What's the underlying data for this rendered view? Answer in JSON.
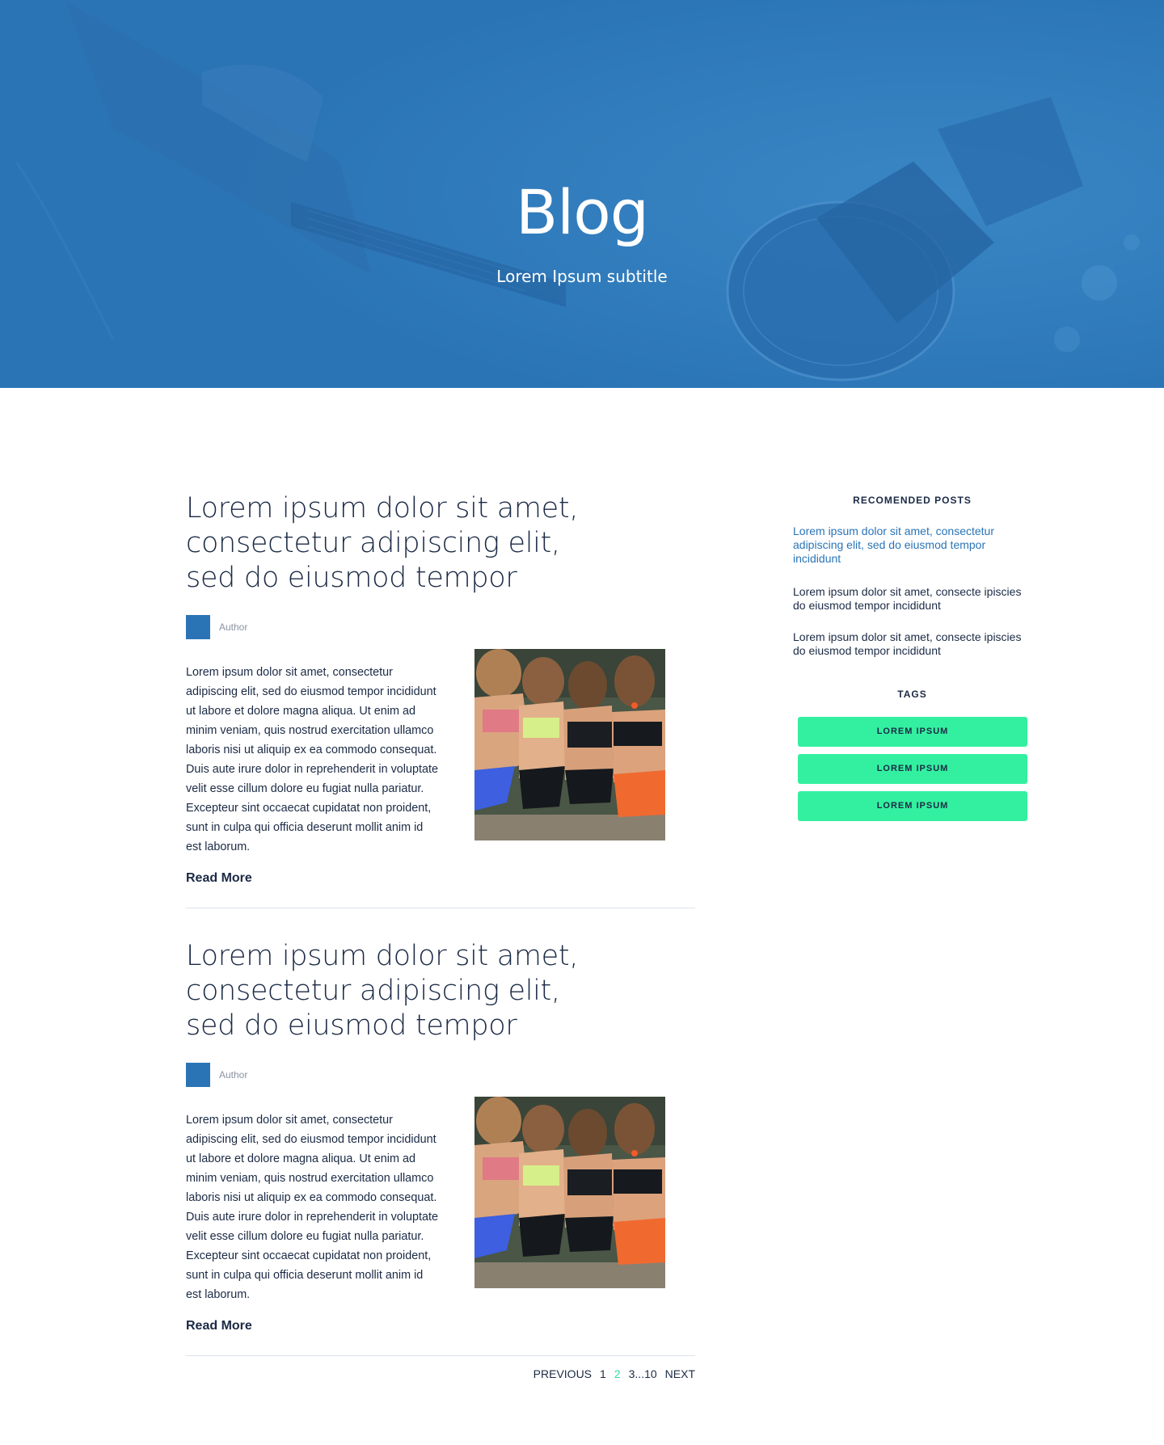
{
  "colors": {
    "brand_blue": "#2a74b6",
    "accent_green": "#33f0a0",
    "text_dark": "#1b2a45",
    "muted": "#8a93a3"
  },
  "hero": {
    "title": "Blog",
    "subtitle": "Lorem Ipsum subtitle"
  },
  "posts": [
    {
      "title_lines": [
        "Lorem ipsum dolor sit amet,",
        "consectetur adipiscing elit,",
        "sed do eiusmod tempor"
      ],
      "author": "Author",
      "body_lines": [
        "Lorem ipsum dolor sit amet, consectetur",
        "adipiscing elit, sed do eiusmod tempor incididunt",
        "ut labore et dolore magna aliqua. Ut enim ad",
        "minim veniam, quis nostrud exercitation ullamco",
        "laboris nisi ut aliquip ex ea commodo consequat.",
        "Duis aute irure dolor in reprehenderit in voluptate",
        "velit esse cillum dolore eu fugiat nulla pariatur.",
        "Excepteur sint occaecat cupidatat non proident,",
        "sunt in culpa qui officia deserunt mollit anim id",
        "est laborum."
      ],
      "read_more": "Read More"
    },
    {
      "title_lines": [
        "Lorem ipsum dolor sit amet,",
        "consectetur adipiscing elit,",
        "sed do eiusmod tempor"
      ],
      "author": "Author",
      "body_lines": [
        "Lorem ipsum dolor sit amet, consectetur",
        "adipiscing elit, sed do eiusmod tempor incididunt",
        "ut labore et dolore magna aliqua. Ut enim ad",
        "minim veniam, quis nostrud exercitation ullamco",
        "laboris nisi ut aliquip ex ea commodo consequat.",
        "Duis aute irure dolor in reprehenderit in voluptate",
        "velit esse cillum dolore eu fugiat nulla pariatur.",
        "Excepteur sint occaecat cupidatat non proident,",
        "sunt in culpa qui officia deserunt mollit anim id",
        "est laborum."
      ],
      "read_more": "Read More"
    }
  ],
  "pagination": {
    "previous": "PREVIOUS",
    "pages": [
      "1",
      "2",
      "3...10"
    ],
    "active_page": "2",
    "next": "NEXT"
  },
  "sidebar": {
    "recommended_heading": "RECOMENDED POSTS",
    "recommended": [
      [
        "Lorem ipsum dolor sit amet, consectetur",
        "adipiscing elit, sed do eiusmod tempor",
        "incididunt"
      ],
      [
        "Lorem ipsum dolor sit amet, consecte ipiscies",
        "do eiusmod tempor incididunt"
      ],
      [
        "Lorem ipsum dolor sit amet, consecte ipiscies",
        "do eiusmod tempor incididunt"
      ]
    ],
    "tags_heading": "TAGS",
    "tags": [
      "LOREM IPSUM",
      "LOREM IPSUM",
      "LOREM IPSUM"
    ]
  }
}
